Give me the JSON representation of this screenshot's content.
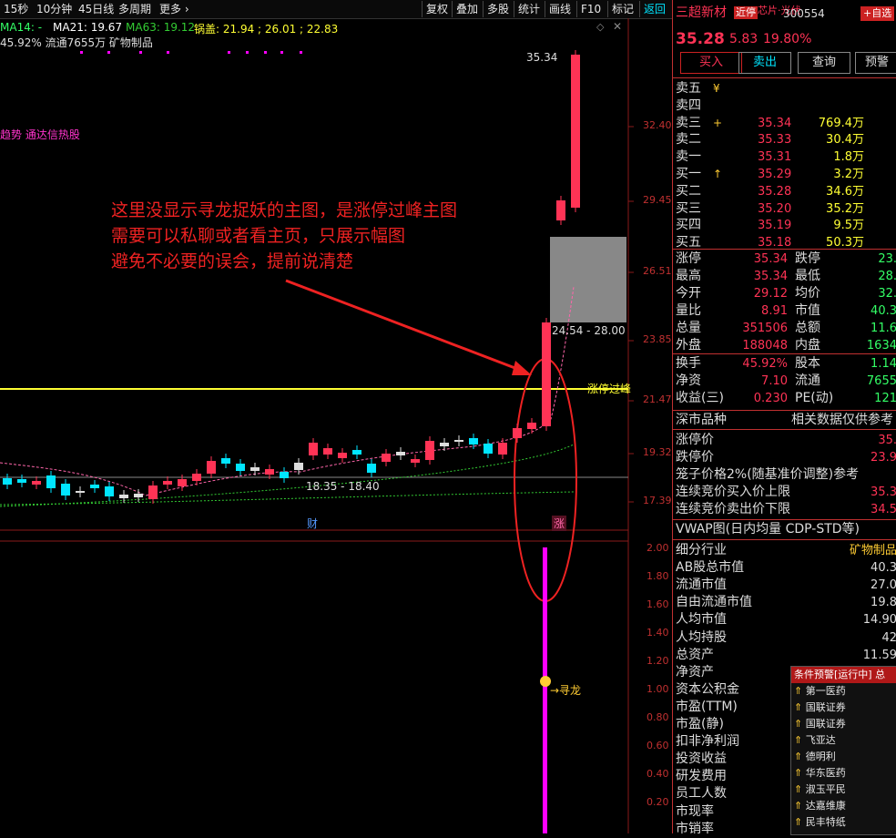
{
  "toolbar": {
    "left_items": [
      "15秒",
      "10分钟",
      "45日线",
      "多周期",
      "更多 ›"
    ],
    "right_items": [
      "复权",
      "叠加",
      "多股",
      "统计",
      "画线",
      "F10",
      "标记",
      "返回"
    ]
  },
  "indicator_line": {
    "ma14": "MA14: -",
    "ma21": "MA21: 19.67",
    "ma63": "MA63: 19.12",
    "guogai": "锅盖: 21.94 ; 26.01 ; 22.83"
  },
  "info_line": "45.92% 流通7655万 矿物制品",
  "side_label": "趋势 通达信热股",
  "annotation": {
    "line1": "这里没显示寻龙捉妖的主图，是涨停过峰主图",
    "line2": "需要可以私聊或者看主页，只展示幅图",
    "line3": "避免不必要的误会，提前说清楚"
  },
  "price_labels": {
    "high": "35.34",
    "box_range": "24.54 - 28.00",
    "low_range": "18.35 - 18.40",
    "yellow_line": "涨停过峰"
  },
  "price_axis": [
    "32.40",
    "29.45",
    "26.51",
    "23.85",
    "21.47",
    "19.32",
    "17.39"
  ],
  "markers": {
    "cai": "财",
    "zhang": "涨"
  },
  "sub_axis": [
    "2.00",
    "1.80",
    "1.60",
    "1.40",
    "1.20",
    "1.00",
    "0.80",
    "0.60",
    "0.40",
    "0.20"
  ],
  "xunlong_label": "→寻龙",
  "colors": {
    "up": "#ff3355",
    "down": "#00e5ff",
    "yellow": "#ffff33",
    "magenta": "#ff00ff",
    "axis": "#c03030"
  },
  "stock": {
    "name": "三超新材",
    "tag": "近停",
    "tag2": "芯片·光伏",
    "code": "300554",
    "add_fav": "+自选",
    "price": "35.28",
    "change": "5.83",
    "pct": "19.80%"
  },
  "buttons": [
    "买入",
    "卖出",
    "查询",
    "预警"
  ],
  "order_book": {
    "sell": [
      {
        "label": "卖五",
        "price": "",
        "vol": "",
        "mark": "¥"
      },
      {
        "label": "卖四",
        "price": "",
        "vol": "",
        "mark": ""
      },
      {
        "label": "卖三",
        "price": "35.34",
        "vol": "769.4万",
        "mark": "+"
      },
      {
        "label": "卖二",
        "price": "35.33",
        "vol": "30.4万",
        "mark": ""
      },
      {
        "label": "卖一",
        "price": "35.31",
        "vol": "1.8万",
        "mark": ""
      }
    ],
    "buy": [
      {
        "label": "买一",
        "price": "35.29",
        "vol": "3.2万",
        "mark": "↑"
      },
      {
        "label": "买二",
        "price": "35.28",
        "vol": "34.6万",
        "mark": ""
      },
      {
        "label": "买三",
        "price": "35.20",
        "vol": "35.2万",
        "mark": ""
      },
      {
        "label": "买四",
        "price": "35.19",
        "vol": "9.5万",
        "mark": ""
      },
      {
        "label": "买五",
        "price": "35.18",
        "vol": "50.3万",
        "mark": ""
      }
    ]
  },
  "stats": [
    {
      "l1": "涨停",
      "v1": "35.34",
      "l2": "跌停",
      "v2": "23."
    },
    {
      "l1": "最高",
      "v1": "35.34",
      "l2": "最低",
      "v2": "28."
    },
    {
      "l1": "今开",
      "v1": "29.12",
      "l2": "均价",
      "v2": "32."
    },
    {
      "l1": "量比",
      "v1": "8.91",
      "l2": "市值",
      "v2": "40.3"
    },
    {
      "l1": "总量",
      "v1": "351506",
      "l2": "总额",
      "v2": "11.6"
    },
    {
      "l1": "外盘",
      "v1": "188048",
      "l2": "内盘",
      "v2": "1634"
    }
  ],
  "stats2": [
    {
      "l1": "换手",
      "v1": "45.92%",
      "l2": "股本",
      "v2": "1.14"
    },
    {
      "l1": "净资",
      "v1": "7.10",
      "l2": "流通",
      "v2": "7655"
    },
    {
      "l1": "收益(三)",
      "v1": "0.230",
      "l2": "PE(动)",
      "v2": "121"
    }
  ],
  "market_header": {
    "left": "深市品种",
    "right": "相关数据仅供参考"
  },
  "limit_rows": [
    {
      "l": "涨停价",
      "v": "35."
    },
    {
      "l": "跌停价",
      "v": "23.9"
    },
    {
      "l": "笼子价格2%(随基准价调整)参考",
      "v": ""
    },
    {
      "l": "连续竞价买入价上限",
      "v": "35.3"
    },
    {
      "l": "连续竞价卖出价下限",
      "v": "34.5"
    }
  ],
  "vwap": "VWAP图(日内均量 CDP-STD等)",
  "fund_rows": [
    {
      "l": "细分行业",
      "v": "矿物制品"
    },
    {
      "l": "AB股总市值",
      "v": "40.3"
    },
    {
      "l": "流通市值",
      "v": "27.0"
    },
    {
      "l": "自由流通市值",
      "v": "19.8"
    },
    {
      "l": "人均市值",
      "v": "14.90"
    },
    {
      "l": "人均持股",
      "v": "42"
    },
    {
      "l": "总资产",
      "v": "11.59"
    },
    {
      "l": "净资产",
      "v": ""
    },
    {
      "l": "资本公积金",
      "v": ""
    },
    {
      "l": "市盈(TTM)",
      "v": ""
    },
    {
      "l": "市盈(静)",
      "v": ""
    },
    {
      "l": "扣非净利润",
      "v": ""
    },
    {
      "l": "投资收益",
      "v": ""
    },
    {
      "l": "研发费用",
      "v": ""
    },
    {
      "l": "员工人数",
      "v": ""
    },
    {
      "l": "市现率",
      "v": ""
    },
    {
      "l": "市销率",
      "v": ""
    }
  ],
  "warning": {
    "title": "条件预警[运行中] 总",
    "items": [
      "第一医药",
      "国联证券",
      "国联证券",
      "飞亚达",
      "德明利",
      "华东医药",
      "淑玉平民",
      "达嘉维康",
      "民丰特纸"
    ]
  }
}
